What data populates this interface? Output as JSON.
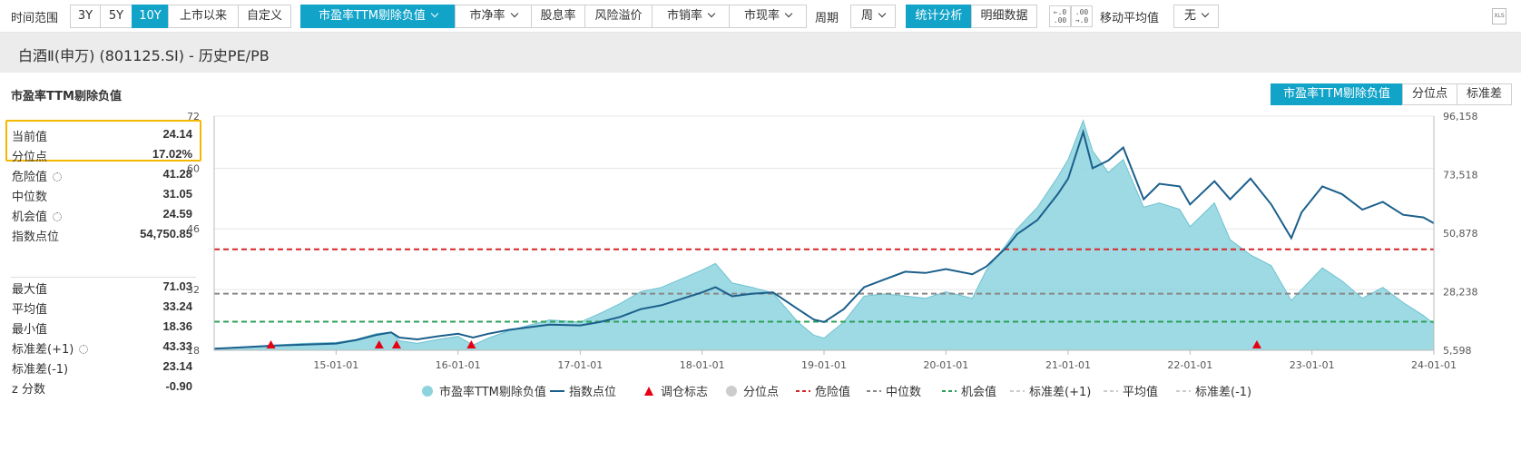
{
  "toolbar": {
    "range_label": "时间范围",
    "ranges": [
      "3Y",
      "5Y",
      "10Y",
      "上市以来",
      "自定义"
    ],
    "active_range": "10Y",
    "metrics": [
      "市盈率TTM剔除负值",
      "市净率",
      "股息率",
      "风险溢价",
      "市销率",
      "市现率"
    ],
    "period_label": "周期",
    "period_value": "周",
    "mode_buttons": [
      "统计分析",
      "明细数据"
    ],
    "decimal_icon_up": "←.0\n.00",
    "decimal_icon_down": ".00\n→.0",
    "ma_label": "移动平均值",
    "ma_value": "无",
    "xls_label": "XLS"
  },
  "title": "白酒Ⅱ(申万) (801125.SI) - 历史PE/PB",
  "panel": {
    "title": "市盈率TTM剔除负值",
    "segments": [
      "市盈率TTM剔除负值",
      "分位点",
      "标准差"
    ]
  },
  "stats": {
    "current_label": "当前值",
    "current": "24.14",
    "pct_label": "分位点",
    "pct": "17.02%",
    "danger_label": "危险值",
    "danger": "41.28",
    "median_label": "中位数",
    "median": "31.05",
    "chance_label": "机会值",
    "chance": "24.59",
    "index_label": "指数点位",
    "index": "54,750.85",
    "max_label": "最大值",
    "max": "71.03",
    "avg_label": "平均值",
    "avg": "33.24",
    "min_label": "最小值",
    "min": "18.36",
    "sdp_label": "标准差(+1)",
    "sdp": "43.33",
    "sdm_label": "标准差(-1)",
    "sdm": "23.14",
    "z_label": "z 分数",
    "z": "-0.90"
  },
  "colors": {
    "accent": "#12a3c8",
    "pe_area": "#8dd3de",
    "index_line": "#1b5f8c",
    "danger": "#d62728",
    "median": "#888888",
    "chance": "#2ca05a",
    "marker": "#e60012",
    "highlight": "#f5b800"
  },
  "chart_data": {
    "type": "area",
    "x_ticks": [
      "15-01-01",
      "16-01-01",
      "17-01-01",
      "18-01-01",
      "19-01-01",
      "20-01-01",
      "21-01-01",
      "22-01-01",
      "23-01-01",
      "24-01-01"
    ],
    "y_left_ticks": [
      "72",
      "60",
      "46",
      "32",
      "18"
    ],
    "y_right_ticks": [
      "96,158",
      "73,518",
      "50,878",
      "28,238",
      "5,598"
    ],
    "y_left_range": [
      18,
      72
    ],
    "y_right_range": [
      5598,
      96158
    ],
    "x_range": [
      "2014-01-01",
      "2024-01-01"
    ],
    "hlines": {
      "danger": 41.28,
      "median": 31.05,
      "chance": 24.59
    },
    "series": [
      {
        "name": "市盈率TTM剔除负值",
        "axis": "left",
        "x": [
          "2014-01-01",
          "2014-04-01",
          "2014-07-01",
          "2014-10-01",
          "2015-01-01",
          "2015-03-01",
          "2015-05-01",
          "2015-06-15",
          "2015-07-10",
          "2015-09-01",
          "2015-11-01",
          "2016-01-01",
          "2016-02-15",
          "2016-04-01",
          "2016-06-01",
          "2016-08-01",
          "2016-10-01",
          "2017-01-01",
          "2017-03-01",
          "2017-05-01",
          "2017-07-01",
          "2017-09-01",
          "2017-11-01",
          "2018-01-01",
          "2018-02-10",
          "2018-04-01",
          "2018-06-01",
          "2018-08-01",
          "2018-10-15",
          "2018-12-01",
          "2019-01-01",
          "2019-03-01",
          "2019-05-01",
          "2019-07-01",
          "2019-09-01",
          "2019-11-01",
          "2020-01-01",
          "2020-03-20",
          "2020-05-01",
          "2020-07-01",
          "2020-08-01",
          "2020-10-01",
          "2020-12-01",
          "2021-01-01",
          "2021-02-15",
          "2021-03-15",
          "2021-05-01",
          "2021-06-15",
          "2021-08-15",
          "2021-10-01",
          "2021-12-01",
          "2022-01-01",
          "2022-03-15",
          "2022-05-01",
          "2022-07-01",
          "2022-09-01",
          "2022-10-31",
          "2022-12-01",
          "2023-02-01",
          "2023-04-01",
          "2023-06-01",
          "2023-08-01",
          "2023-10-01",
          "2023-12-01",
          "2024-01-01"
        ],
        "values": [
          18.4,
          18.8,
          19.2,
          19.6,
          19.8,
          20.5,
          21.8,
          22.2,
          20.2,
          19.6,
          20.5,
          21.2,
          19.2,
          20.8,
          22.5,
          23.8,
          25.0,
          24.5,
          26.5,
          28.8,
          31.5,
          32.5,
          34.5,
          36.5,
          38.0,
          33.5,
          32.5,
          31.2,
          24.5,
          21.5,
          20.8,
          24.5,
          30.5,
          31.0,
          30.5,
          30.0,
          31.5,
          30.0,
          36.5,
          42.5,
          46.0,
          51.0,
          58.0,
          62.0,
          71.0,
          64.0,
          59.0,
          62.0,
          51.0,
          52.0,
          50.5,
          46.5,
          52.0,
          43.5,
          40.0,
          37.5,
          29.5,
          32.0,
          37.0,
          34.0,
          30.0,
          32.5,
          29.0,
          26.0,
          24.14
        ]
      },
      {
        "name": "指数点位",
        "axis": "right",
        "x": [
          "2014-01-01",
          "2014-04-01",
          "2014-07-01",
          "2014-10-01",
          "2015-01-01",
          "2015-03-01",
          "2015-05-01",
          "2015-06-15",
          "2015-07-10",
          "2015-09-01",
          "2015-11-01",
          "2016-01-01",
          "2016-02-15",
          "2016-04-01",
          "2016-06-01",
          "2016-08-01",
          "2016-10-01",
          "2017-01-01",
          "2017-03-01",
          "2017-05-01",
          "2017-07-01",
          "2017-09-01",
          "2017-11-01",
          "2018-01-01",
          "2018-02-10",
          "2018-04-01",
          "2018-06-01",
          "2018-08-01",
          "2018-10-15",
          "2018-12-01",
          "2019-01-01",
          "2019-03-01",
          "2019-05-01",
          "2019-07-01",
          "2019-09-01",
          "2019-11-01",
          "2020-01-01",
          "2020-03-20",
          "2020-05-01",
          "2020-07-01",
          "2020-08-01",
          "2020-10-01",
          "2020-12-01",
          "2021-01-01",
          "2021-02-15",
          "2021-03-15",
          "2021-05-01",
          "2021-06-15",
          "2021-08-15",
          "2021-10-01",
          "2021-12-01",
          "2022-01-01",
          "2022-03-15",
          "2022-05-01",
          "2022-07-01",
          "2022-09-01",
          "2022-10-31",
          "2022-12-01",
          "2023-02-01",
          "2023-04-01",
          "2023-06-01",
          "2023-08-01",
          "2023-10-01",
          "2023-12-01",
          "2024-01-01"
        ],
        "values": [
          6200,
          6800,
          7400,
          7800,
          8200,
          9500,
          11500,
          12500,
          10500,
          9800,
          11000,
          12000,
          10500,
          12000,
          13500,
          14500,
          15500,
          15200,
          16500,
          18500,
          21500,
          23000,
          25500,
          28000,
          30000,
          26500,
          27500,
          28000,
          21500,
          17500,
          16500,
          21500,
          30000,
          33000,
          36000,
          35500,
          37000,
          35000,
          38000,
          45500,
          50500,
          56000,
          66000,
          72000,
          90000,
          76000,
          79000,
          84000,
          64000,
          70000,
          69000,
          62000,
          71000,
          64000,
          72000,
          62000,
          49000,
          59000,
          69000,
          66000,
          60000,
          63000,
          58000,
          57000,
          54750
        ]
      }
    ],
    "markers": {
      "name": "调仓标志",
      "x": [
        "2014-06-20",
        "2015-05-10",
        "2015-07-01",
        "2016-02-10",
        "2022-07-20"
      ]
    },
    "legend": [
      "市盈率TTM剔除负值",
      "指数点位",
      "调仓标志",
      "分位点",
      "危险值",
      "中位数",
      "机会值",
      "标准差(+1)",
      "平均值",
      "标准差(-1)"
    ]
  }
}
